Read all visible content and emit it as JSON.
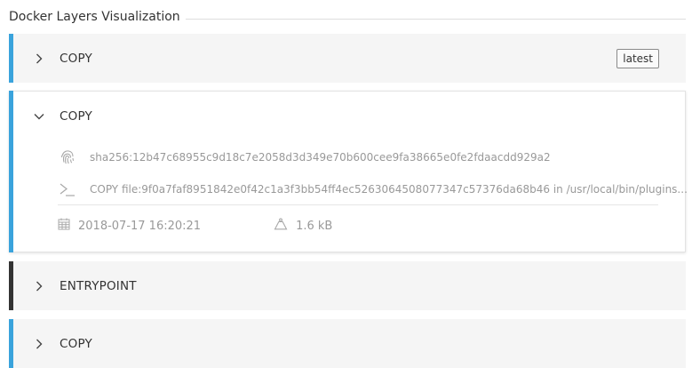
{
  "header": {
    "title": "Docker Layers Visualization"
  },
  "layers": [
    {
      "command": "COPY",
      "tag": "latest",
      "accent_color": "#3aa3dc",
      "expanded": false
    },
    {
      "command": "COPY",
      "accent_color": "#3aa3dc",
      "expanded": true,
      "digest": "sha256:12b47c68955c9d18c7e2058d3d349e70b600cee9fa38665e0fe2fdaacdd929a2",
      "instruction": "COPY file:9f0a7faf8951842e0f42c1a3f3bb54ff4ec5263064508077347c57376da68b46 in /usr/local/bin/plugins...",
      "created": "2018-07-17 16:20:21",
      "size": "1.6 kB"
    },
    {
      "command": "ENTRYPOINT",
      "accent_color": "#333333",
      "expanded": false
    },
    {
      "command": "COPY",
      "accent_color": "#3aa3dc",
      "expanded": false
    }
  ],
  "icons": {
    "collapsed": "chevron-right-icon",
    "expanded": "chevron-down-icon",
    "digest": "fingerprint-icon",
    "instruction": "terminal-icon",
    "created": "calendar-icon",
    "size": "weight-icon"
  },
  "colors": {
    "accent_blue": "#3aa3dc",
    "accent_dark": "#333333",
    "collapsed_bg": "#f5f5f5",
    "muted_text": "#999999"
  }
}
